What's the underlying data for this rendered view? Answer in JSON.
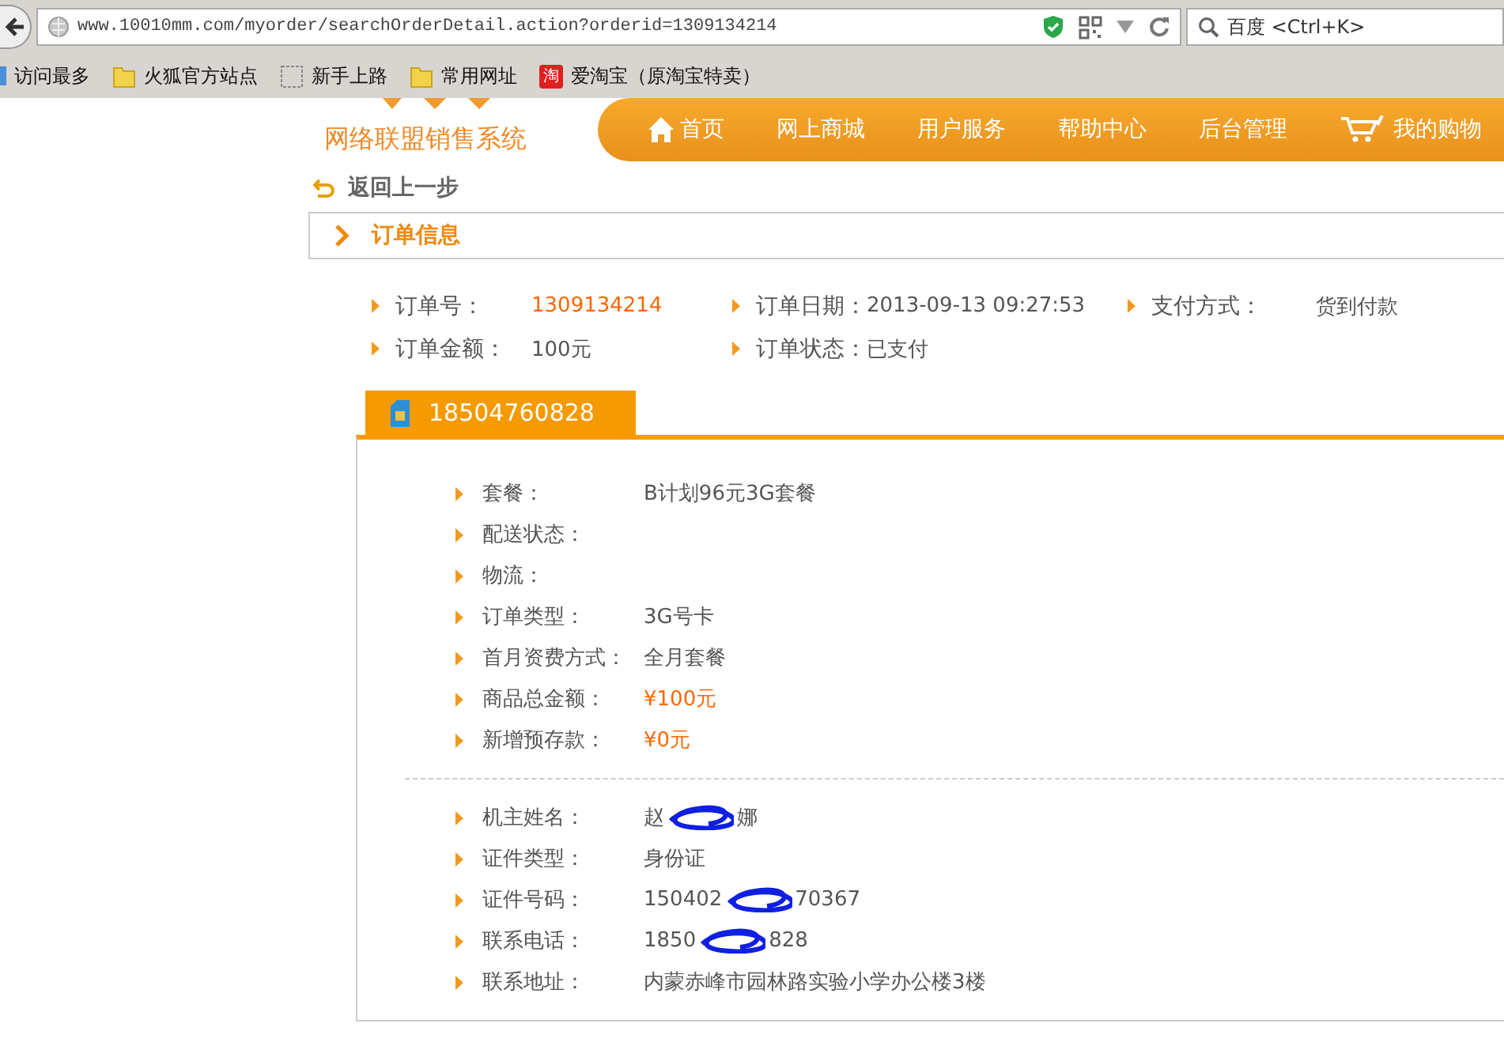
{
  "browser": {
    "url": "www.10010mm.com/myorder/searchOrderDetail.action?orderid=1309134214",
    "search_placeholder": "百度 <Ctrl+K>",
    "bookmarks": [
      {
        "label": "访问最多",
        "kind": "frequent"
      },
      {
        "label": "火狐官方站点",
        "kind": "folder"
      },
      {
        "label": "新手上路",
        "kind": "page"
      },
      {
        "label": "常用网址",
        "kind": "folder"
      },
      {
        "label": "爱淘宝（原淘宝特卖）",
        "kind": "taobao",
        "badge": "淘"
      }
    ]
  },
  "site": {
    "logo": "网络联盟销售系统",
    "nav": [
      {
        "label": "首页",
        "kind": "home"
      },
      {
        "label": "网上商城",
        "kind": "plain"
      },
      {
        "label": "用户服务",
        "kind": "plain"
      },
      {
        "label": "帮助中心",
        "kind": "plain"
      },
      {
        "label": "后台管理",
        "kind": "plain"
      },
      {
        "label": "我的购物",
        "kind": "cart"
      }
    ]
  },
  "back_link": "返回上一步",
  "section_title": "订单信息",
  "order_info": [
    [
      {
        "label": "订单号：",
        "value": "1309134214",
        "highlight": true
      },
      {
        "label": "订单日期：",
        "value": "2013-09-13 09:27:53",
        "highlight": false
      },
      {
        "label": "支付方式：",
        "value": "货到付款",
        "highlight": false
      }
    ],
    [
      {
        "label": "订单金额：",
        "value": "100元",
        "highlight": false
      },
      {
        "label": "订单状态：",
        "value": "已支付",
        "highlight": false
      }
    ]
  ],
  "card": {
    "tab": "18504760828",
    "groups": [
      [
        {
          "label": "套餐：",
          "value_parts": [
            "B计划96元3G套餐"
          ],
          "highlight": false
        },
        {
          "label": "配送状态："
        },
        {
          "label": "物流："
        },
        {
          "label": "订单类型：",
          "value_parts": [
            "3G号卡"
          ],
          "highlight": false
        },
        {
          "label": "首月资费方式：",
          "value_parts": [
            "全月套餐"
          ],
          "highlight": false
        },
        {
          "label": "商品总金额：",
          "value_parts": [
            "¥100元"
          ],
          "highlight": true
        },
        {
          "label": "新增预存款：",
          "value_parts": [
            "¥0元"
          ],
          "highlight": true
        }
      ],
      [
        {
          "label": "机主姓名：",
          "value_parts": [
            "赵",
            "娜"
          ],
          "highlight": false
        },
        {
          "label": "证件类型：",
          "value_parts": [
            "身份证"
          ],
          "highlight": false
        },
        {
          "label": "证件号码：",
          "value_parts": [
            "150402",
            "70367"
          ],
          "highlight": false
        },
        {
          "label": "联系电话：",
          "value_parts": [
            "1850",
            "828"
          ],
          "highlight": false
        },
        {
          "label": "联系地址：",
          "value_parts": [
            "内蒙赤峰市园林路实验小学办公楼3楼"
          ],
          "highlight": false
        }
      ]
    ]
  }
}
